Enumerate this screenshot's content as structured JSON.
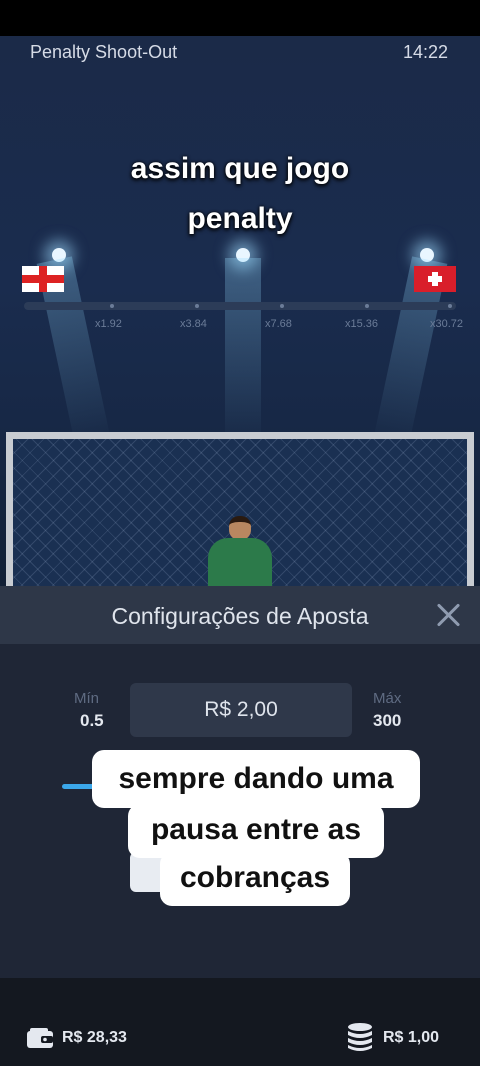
{
  "header": {
    "title": "Penalty Shoot-Out",
    "time": "14:22"
  },
  "caption_top": {
    "line1": "assim que jogo",
    "line2": "penalty"
  },
  "teams": {
    "left_flag": "england-flag-icon",
    "right_flag": "switzerland-flag-icon"
  },
  "multipliers": [
    "x1.92",
    "x3.84",
    "x7.68",
    "x15.36",
    "x30.72"
  ],
  "bet_panel": {
    "title": "Configurações de Aposta",
    "min_label": "Mín",
    "min_value": "0.5",
    "max_label": "Máx",
    "max_value": "300",
    "amount": "R$ 2,00"
  },
  "caption_bottom": {
    "line1": "sempre dando uma",
    "line2": "pausa entre as",
    "line3": "cobranças"
  },
  "footer": {
    "balance": "R$ 28,33",
    "bet": "R$ 1,00"
  },
  "icons": {
    "wallet": "wallet-icon",
    "coins": "coin-stack-icon",
    "close": "close-icon"
  },
  "colors": {
    "accent": "#3ba7ea",
    "panel": "#1f2636",
    "panel_header": "#2e3748"
  }
}
